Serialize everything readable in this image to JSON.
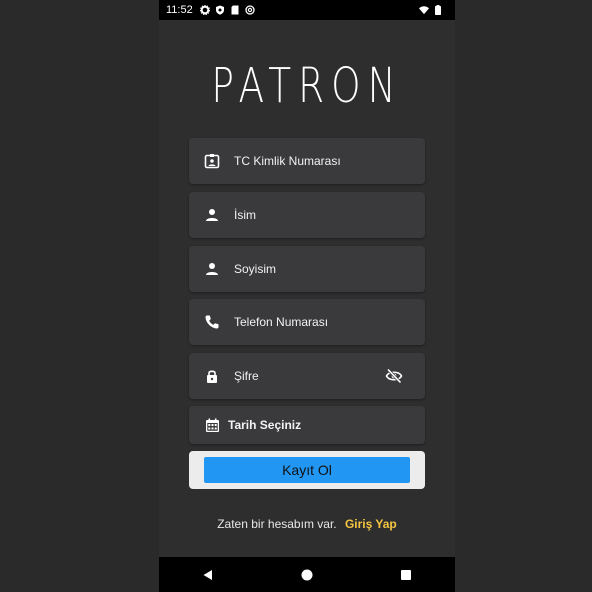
{
  "status_bar": {
    "time": "11:52",
    "icons": [
      "gear-icon",
      "shield-icon",
      "sim-card-icon",
      "at-sign-icon",
      "wifi-icon",
      "battery-icon"
    ]
  },
  "app": {
    "logo": "PATRON"
  },
  "form": {
    "fields": [
      {
        "label": "TC Kimlik Numarası",
        "icon": "id-badge-icon"
      },
      {
        "label": "İsim",
        "icon": "person-icon"
      },
      {
        "label": "Soyisim",
        "icon": "person-icon"
      },
      {
        "label": "Telefon Numarası",
        "icon": "phone-icon"
      },
      {
        "label": "Şifre",
        "icon": "lock-icon",
        "toggle_icon": "eye-off-icon"
      }
    ],
    "date_label": "Tarih Seçiniz",
    "date_icon": "calendar-icon",
    "submit_label": "Kayıt Ol"
  },
  "footer": {
    "text": "Zaten bir hesabım var.",
    "link": "Giriş Yap"
  },
  "colors": {
    "background": "#2e2e2e",
    "field": "#3a3a3c",
    "button": "#2196f3",
    "link": "#f5c542"
  }
}
